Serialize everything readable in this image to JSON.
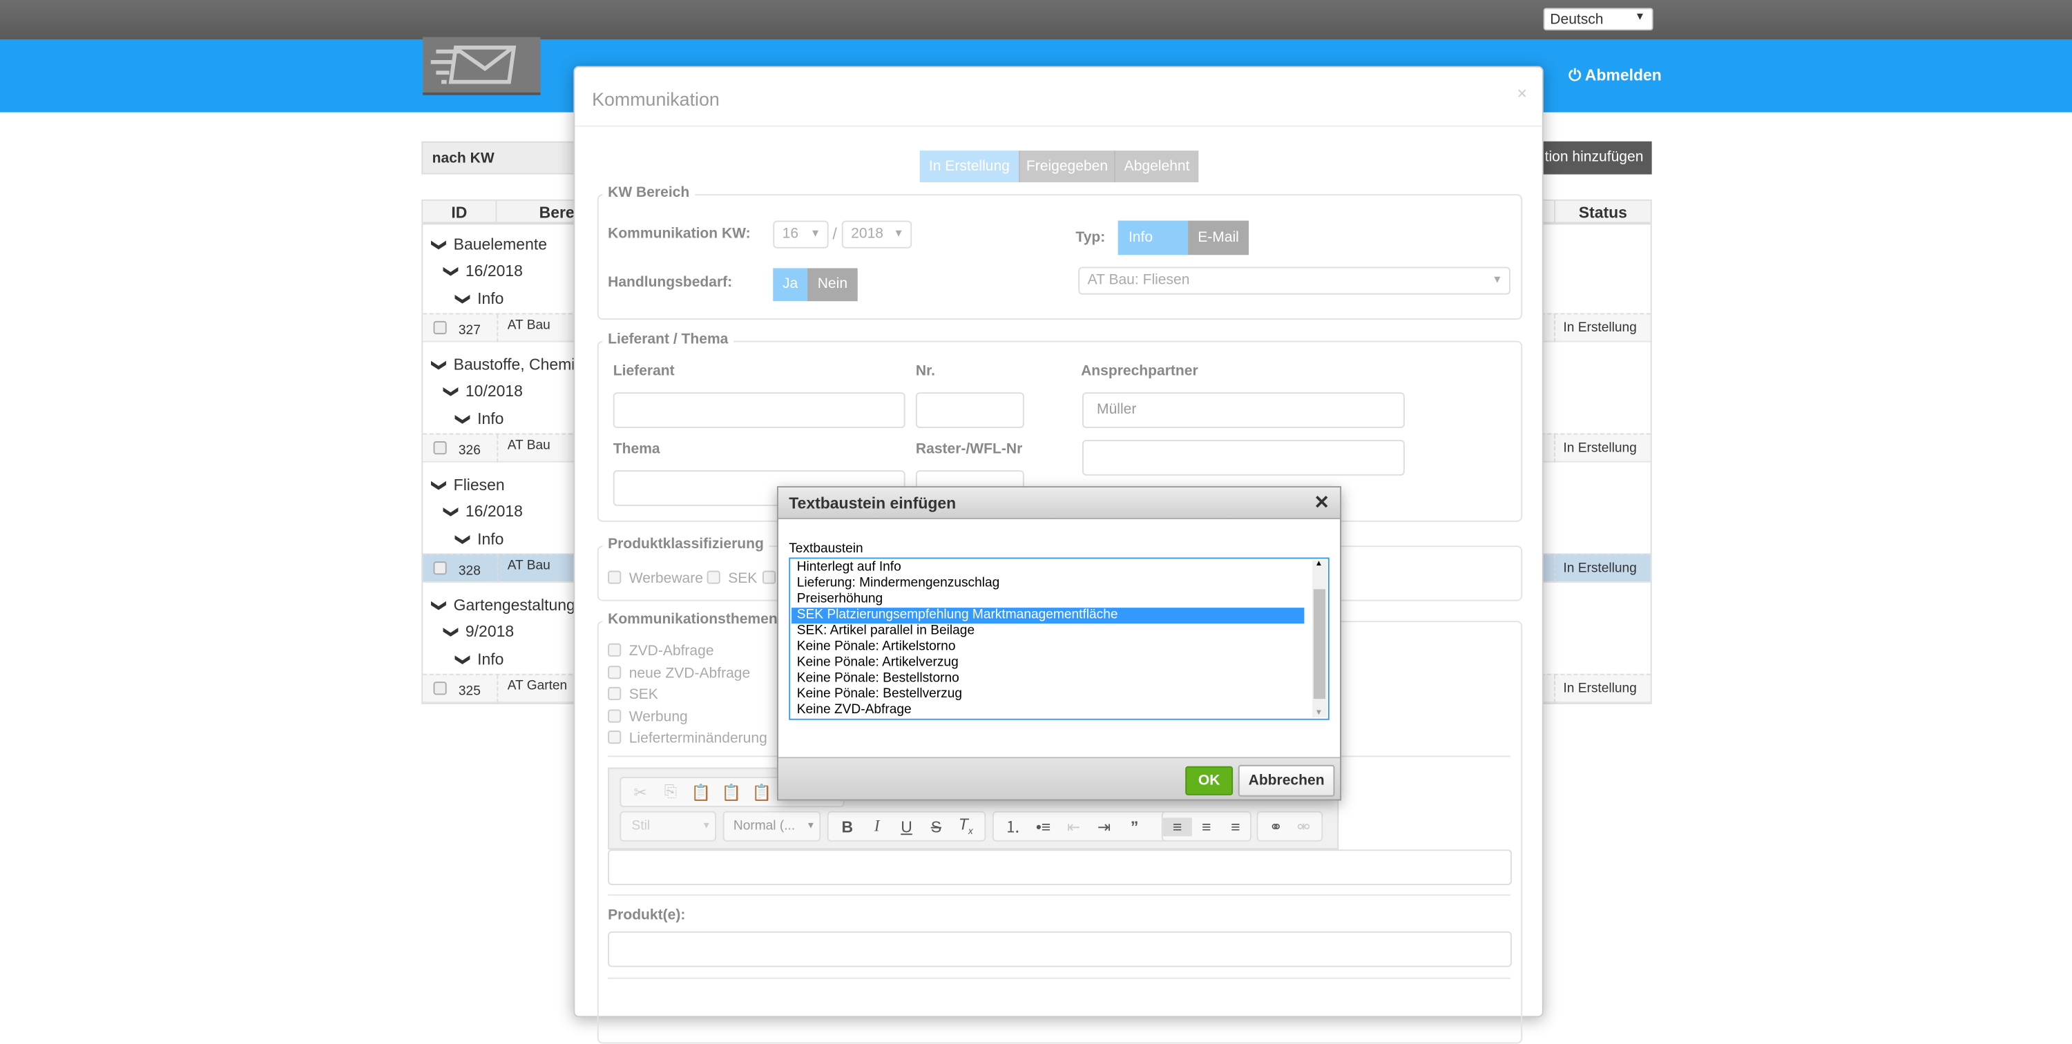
{
  "header": {
    "language": "Deutsch",
    "logout": "Abmelden",
    "logo": "envelope-logo"
  },
  "toolbar": {
    "filter": "nach KW",
    "add_button": "tion hinzufügen"
  },
  "table": {
    "headers": {
      "id": "ID",
      "bereich": "Berei",
      "status": "Status"
    },
    "groups": [
      {
        "name": "Bauelemente",
        "kw": "16/2018",
        "typ": "Info",
        "row": {
          "id": "327",
          "bereich": "AT Bau",
          "status": "In Erstellung"
        }
      },
      {
        "name": "Baustoffe, Chemie",
        "kw": "10/2018",
        "typ": "Info",
        "row": {
          "id": "326",
          "bereich": "AT Bau",
          "status": "In Erstellung"
        }
      },
      {
        "name": "Fliesen",
        "kw": "16/2018",
        "typ": "Info",
        "row": {
          "id": "328",
          "bereich": "AT Bau",
          "status": "In Erstellung"
        }
      },
      {
        "name": "Gartengestaltung",
        "kw": "9/2018",
        "typ": "Info",
        "row": {
          "id": "325",
          "bereich": "AT Garten",
          "status": "In Erstellung"
        }
      }
    ]
  },
  "modal": {
    "title": "Kommunikation",
    "close": "×",
    "status_tabs": [
      "In Erstellung",
      "Freigegeben",
      "Abgelehnt"
    ],
    "kw": {
      "legend": "KW Bereich",
      "kw_label": "Kommunikation KW:",
      "week": "16",
      "sep": "/",
      "year": "2018",
      "typ_label": "Typ:",
      "typ_options": [
        "Info",
        "E-Mail"
      ],
      "handlung_label": "Handlungsbedarf:",
      "handlung_options": [
        "Ja",
        "Nein"
      ],
      "bereich": "AT Bau: Fliesen"
    },
    "lieferant": {
      "legend": "Lieferant / Thema",
      "lieferant": "Lieferant",
      "nr": "Nr.",
      "ansprechpartner": "Ansprechpartner",
      "ansprechpartner_value": "Müller",
      "thema": "Thema",
      "raster": "Raster-/WFL-Nr"
    },
    "produkt": {
      "legend": "Produktklassifizierung",
      "options": [
        "Werbeware",
        "SEK"
      ]
    },
    "themen": {
      "legend": "Kommunikationsthemen",
      "options": [
        "ZVD-Abfrage",
        "neue ZVD-Abfrage",
        "SEK",
        "Werbung",
        "Lieferterminänderung"
      ]
    },
    "editor": {
      "style": "Stil",
      "format": "Normal (..."
    },
    "produkte_label": "Produkt(e):"
  },
  "dialog": {
    "title": "Textbaustein einfügen",
    "label": "Textbaustein",
    "items": [
      "Hinterlegt auf Info",
      "Lieferung: Mindermengenzuschlag",
      "Preiserhöhung",
      "SEK Platzierungsempfehlung Marktmanagementfläche",
      "SEK: Artikel parallel in Beilage",
      "Keine Pönale: Artikelstorno",
      "Keine Pönale: Artikelverzug",
      "Keine Pönale: Bestellstorno",
      "Keine Pönale: Bestellverzug",
      "Keine ZVD-Abfrage"
    ],
    "selected": "SEK Platzierungsempfehlung Marktmanagementfläche",
    "ok": "OK",
    "cancel": "Abbrechen"
  }
}
